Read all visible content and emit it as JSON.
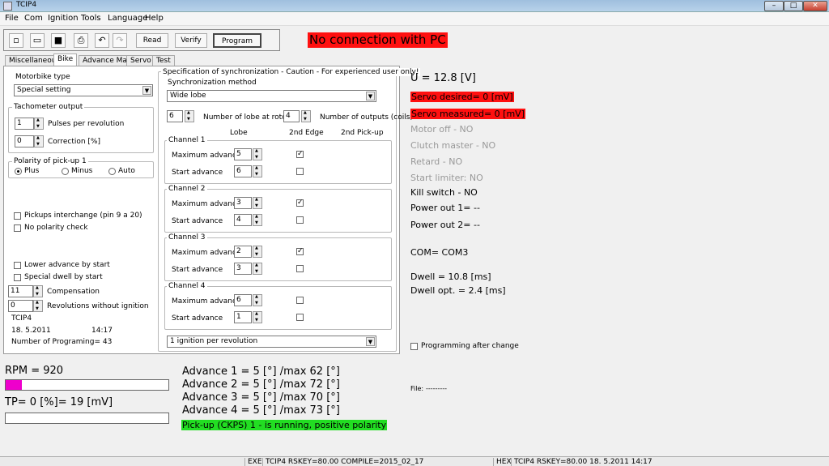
{
  "window": {
    "title": "TCIP4"
  },
  "menu": [
    "File",
    "Com",
    "Ignition",
    "Tools",
    "Language",
    "Help"
  ],
  "toolbar": {
    "read": "Read",
    "verify": "Verify",
    "program": "Program"
  },
  "connection_status": "No connection with PC",
  "tabs": [
    "Miscellaneous",
    "Bike",
    "Advance Map",
    "Servo",
    "Test"
  ],
  "bike": {
    "motorbike_type_label": "Motorbike type",
    "motorbike_type": "Special setting",
    "tach_label": "Tachometer output",
    "pulses_value": "1",
    "pulses_label": "Pulses per revolution",
    "correction_value": "0",
    "correction_label": "Correction [%]",
    "polarity_label": "Polarity of pick-up 1",
    "polarity_options": [
      "Plus",
      "Minus",
      "Auto"
    ],
    "polarity_selected": "Plus",
    "pickups_interchange": "Pickups interchange (pin 9 a 20)",
    "no_polarity_check": "No polarity check",
    "lower_advance": "Lower advance by start",
    "special_dwell": "Special dwell by start",
    "compensation_value": "11",
    "compensation_label": "Compensation",
    "rev_value": "0",
    "rev_label": "Revolutions without ignition",
    "device": "TCIP4",
    "date": "18. 5.2011",
    "time": "14:17",
    "programing_count": "Number of Programing= 43"
  },
  "sync": {
    "title": "Specification of synchronization - Caution - For experienced user only!",
    "method_label": "Synchronization method",
    "method": "Wide lobe",
    "lobe_value": "6",
    "lobe_label": "Number of lobe at rotor",
    "outputs_value": "4",
    "outputs_label": "Number of outputs (coils)",
    "col_lobe": "Lobe",
    "col_edge": "2nd Edge",
    "col_pickup": "2nd Pick-up",
    "max_label": "Maximum advance",
    "start_label": "Start advance",
    "channels": [
      {
        "name": "Channel 1",
        "max": "5",
        "start": "6",
        "edge": true
      },
      {
        "name": "Channel 2",
        "max": "3",
        "start": "4",
        "edge": true
      },
      {
        "name": "Channel 3",
        "max": "2",
        "start": "3",
        "edge": true
      },
      {
        "name": "Channel 4",
        "max": "6",
        "start": "1",
        "edge": false
      }
    ],
    "ignition_mode": "1 ignition per revolution"
  },
  "status": {
    "voltage": "U = 12.8 [V]",
    "servo_desired": "Servo desired= 0 [mV]",
    "servo_measured": "Servo measured= 0 [mV]",
    "motor_off": "Motor off - NO",
    "clutch_master": "Clutch master - NO",
    "retard": "Retard - NO",
    "start_limiter": "Start limiter: NO",
    "kill_switch": "Kill switch - NO",
    "power_out1": "Power out 1= --",
    "power_out2": "Power out 2= --",
    "com": "COM= COM3",
    "dwell": "Dwell = 10.8 [ms]",
    "dwell_opt": "Dwell opt. = 2.4 [ms]",
    "programming_after_change": "Programming after change",
    "file_label": "File:",
    "file_value": "---------"
  },
  "bottom": {
    "rpm": "RPM = 920",
    "rpm_fraction": 0.1,
    "tp": "TP= 0 [%]= 19 [mV]",
    "tp_fraction": 0,
    "advances": [
      "Advance 1 = 5 [°] /max 62 [°]",
      "Advance 2 = 5 [°] /max 72 [°]",
      "Advance 3 = 5 [°] /max 70 [°]",
      "Advance 4 = 5 [°] /max 73 [°]"
    ],
    "pickup_status": "Pick-up (CKPS) 1 - is running, positive polarity"
  },
  "statusbar": {
    "exe": "EXE",
    "exe_info": "TCIP4    RSKEY=80.00    COMPILE=2015_02_17",
    "hex": "HEX",
    "hex_info": "TCIP4    RSKEY=80.00    18. 5.2011    14:17"
  },
  "colors": {
    "warning": "#ff1010",
    "ok": "#22dd22",
    "rpm_bar": "#ee00cc"
  }
}
